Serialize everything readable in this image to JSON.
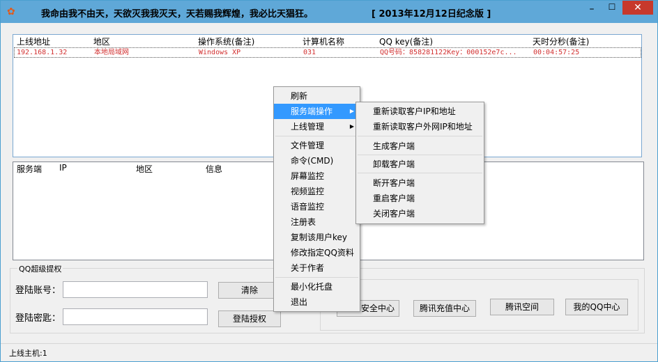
{
  "window": {
    "title": "我命由我不由天，天欲灭我我灭天，天若赐我辉煌，我必比天猖狂。",
    "edition": "[ 2013年12月12日纪念版 ]",
    "min": "–",
    "max": "☐",
    "close": "✕",
    "icon": "flower-icon"
  },
  "top_list": {
    "headers": [
      "上线地址",
      "地区",
      "操作系统(备注)",
      "计算机名称",
      "QQ key(备注)",
      "天时分秒(备注)"
    ],
    "rows": [
      {
        "ip": "192.168.1.32",
        "region": "本地局域网",
        "os": "Windows XP",
        "name": "031",
        "qq": "QQ号码：858281122Key：000152e7c...",
        "time": "00:04:57:25"
      }
    ]
  },
  "bottom_list": {
    "headers": [
      "服务端",
      "IP",
      "地区",
      "信息"
    ]
  },
  "qq_group": {
    "title": "QQ超级提权",
    "account_label": "登陆账号：",
    "password_label": "登陆密匙：",
    "clear_label": "清除",
    "login_label": "登陆授权",
    "security_label": "安全中心",
    "recharge_label": "腾讯充值中心",
    "space_label": "腾讯空间",
    "myqq_label": "我的QQ中心",
    "account_value": "",
    "password_value": ""
  },
  "status": {
    "text": "上线主机:1"
  },
  "context_menu": {
    "items": [
      "刷新",
      "服务端操作",
      "上线管理",
      "文件管理",
      "命令(CMD)",
      "屏幕监控",
      "视频监控",
      "语音监控",
      "注册表",
      "复制该用户key",
      "修改指定QQ资料",
      "关于作者",
      "最小化托盘",
      "退出"
    ]
  },
  "submenu": {
    "items": [
      "重新读取客户IP和地址",
      "重新读取客户外网IP和地址",
      "生成客户端",
      "卸载客户端",
      "断开客户端",
      "重启客户端",
      "关闭客户端"
    ]
  },
  "colors": {
    "titlebar": "#5fa8d8",
    "highlight": "#3399ff",
    "row_text": "#d23030",
    "close": "#c7392c"
  }
}
